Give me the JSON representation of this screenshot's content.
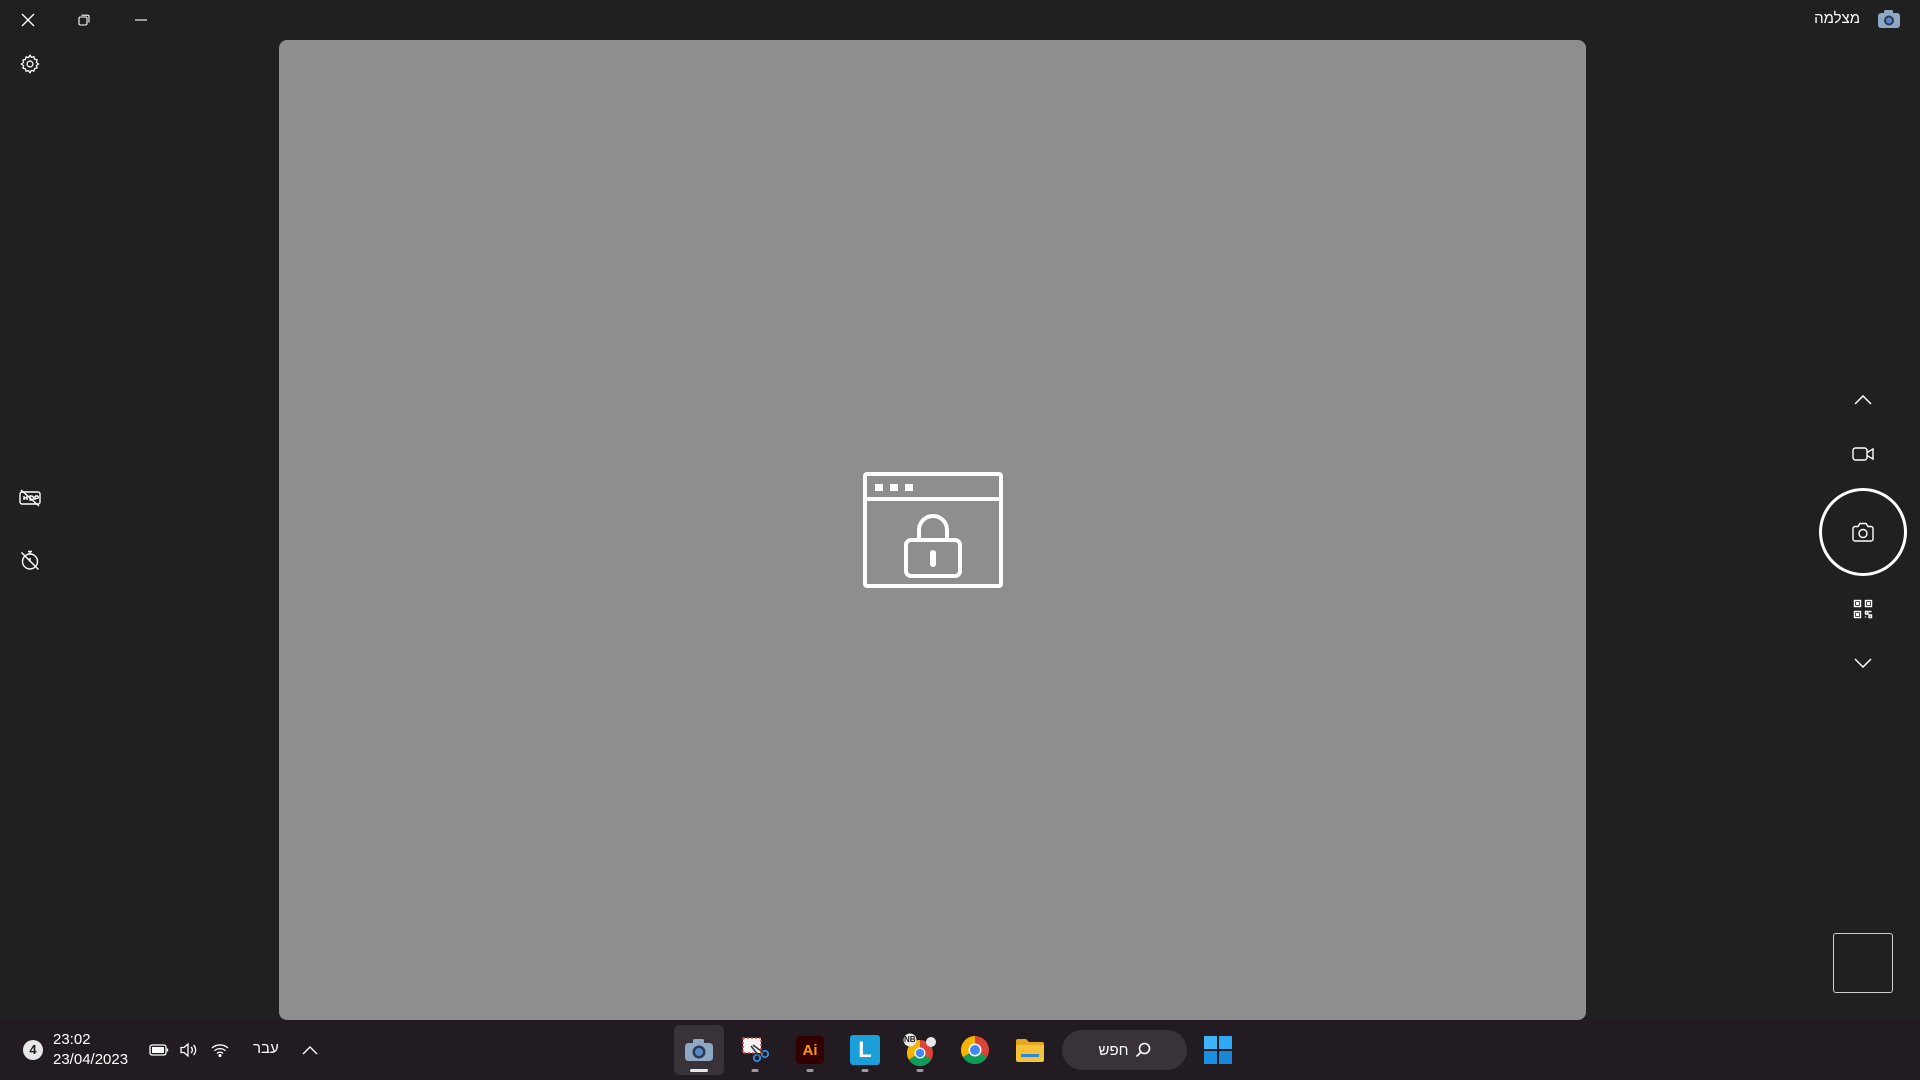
{
  "window": {
    "title": "מצלמה",
    "icons": {
      "close": "close-icon",
      "restore": "restore-icon",
      "minimize": "minimize-icon",
      "app": "camera-app-icon"
    }
  },
  "preview": {
    "background": "#8e8e8e",
    "illustration": "browser-lock-icon"
  },
  "left_controls": {
    "settings": "gear-icon",
    "hdr_off": "hdr-off-icon",
    "timer_off": "timer-off-icon"
  },
  "capture_rail": {
    "scroll_up": "chevron-up-icon",
    "video_mode": "video-camera-icon",
    "photo_shutter": "camera-icon",
    "qr_mode": "qr-code-icon",
    "scroll_down": "chevron-down-icon"
  },
  "taskbar": {
    "notification_count": "4",
    "time": "23:02",
    "date": "23/04/2023",
    "language": "עבר",
    "search_label": "חפש",
    "tray_icons": [
      "battery-icon",
      "volume-icon",
      "wifi-icon",
      "chevron-up-icon"
    ],
    "apps": [
      {
        "name": "camera-app",
        "icon": "camera-icon",
        "active": true
      },
      {
        "name": "snipping-tool-app",
        "icon": "snipping-icon",
        "active": false
      },
      {
        "name": "illustrator-app",
        "icon": "illustrator-icon",
        "label": "Ai",
        "active": false
      },
      {
        "name": "l-app",
        "icon": "l-icon",
        "label": "L",
        "active": false
      },
      {
        "name": "chrome-profile-app",
        "icon": "chrome-profile-icon",
        "label": "NB",
        "active": false
      },
      {
        "name": "chrome-app",
        "icon": "chrome-icon",
        "active": false
      },
      {
        "name": "file-explorer-app",
        "icon": "folder-icon",
        "active": false
      }
    ],
    "start": "windows-start-icon"
  },
  "colors": {
    "background": "#202020",
    "taskbar": "#231b22",
    "illustrator": "#ff9a00",
    "l_app": "#1a9fd8",
    "windows_blue": "#2ea9f5",
    "folder": "#f5c33b"
  }
}
